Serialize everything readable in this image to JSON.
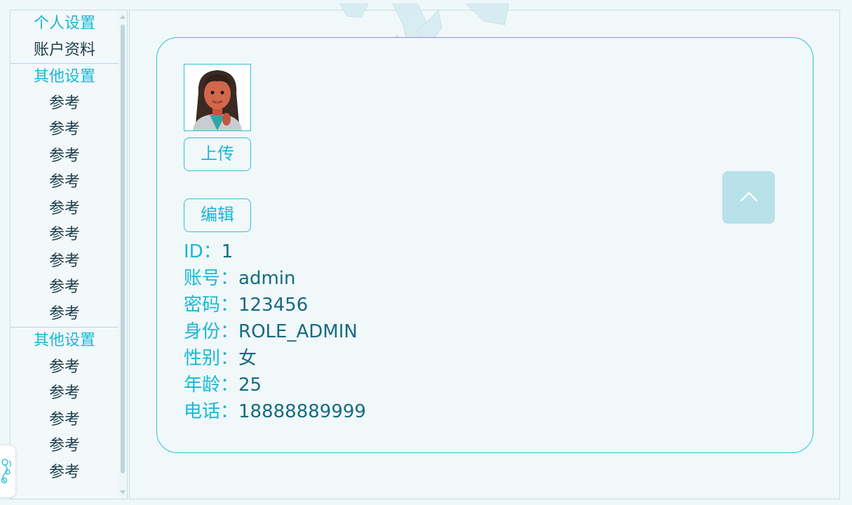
{
  "sidebar": {
    "sections": [
      {
        "label": "个人设置",
        "active": true
      },
      {
        "label": "账户资料"
      }
    ],
    "group1": {
      "label": "其他设置",
      "items": [
        "参考",
        "参考",
        "参考",
        "参考",
        "参考",
        "参考",
        "参考",
        "参考",
        "参考"
      ]
    },
    "group2": {
      "label": "其他设置",
      "items": [
        "参考",
        "参考",
        "参考",
        "参考",
        "参考"
      ]
    }
  },
  "profile": {
    "upload_label": "上传",
    "edit_label": "编辑",
    "fields": [
      {
        "label": "ID：",
        "value": "1"
      },
      {
        "label": "账号：",
        "value": "admin"
      },
      {
        "label": "密码：",
        "value": "123456"
      },
      {
        "label": "身份：",
        "value": "ROLE_ADMIN"
      },
      {
        "label": "性别：",
        "value": "女"
      },
      {
        "label": "年龄：",
        "value": "25"
      },
      {
        "label": "电话：",
        "value": "18888889999"
      }
    ]
  },
  "icons": {
    "avatar": "avatar-image",
    "back_to_top": "chevron-up-icon",
    "floating_widget": "decorative-floral-icon",
    "decoration": "snowflake-decoration"
  },
  "colors": {
    "accent": "#18b8d4",
    "value_text": "#176b80",
    "border": "#2dc1d9",
    "background": "#eef7f9"
  }
}
